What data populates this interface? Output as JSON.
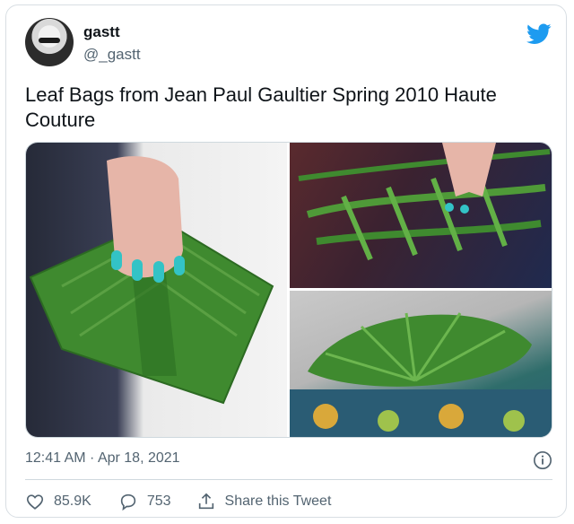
{
  "user": {
    "display_name": "gastt",
    "handle": "@_gastt"
  },
  "tweet": {
    "text": "Leaf Bags from Jean Paul Gaultier Spring 2010 Haute Couture",
    "timestamp": "12:41 AM · Apr 18, 2021"
  },
  "media": {
    "images": [
      {
        "icon": "photo-leaf-clutch-held"
      },
      {
        "icon": "photo-woven-leaf-bag"
      },
      {
        "icon": "photo-fan-leaf-bag"
      }
    ]
  },
  "actions": {
    "likes": "85.9K",
    "replies": "753",
    "share_label": "Share this Tweet"
  },
  "colors": {
    "brand_blue": "#1d9bf0",
    "text_primary": "#0f1419",
    "text_secondary": "#536471",
    "border": "#cfd9de",
    "leaf_green": "#3f8a2f"
  }
}
